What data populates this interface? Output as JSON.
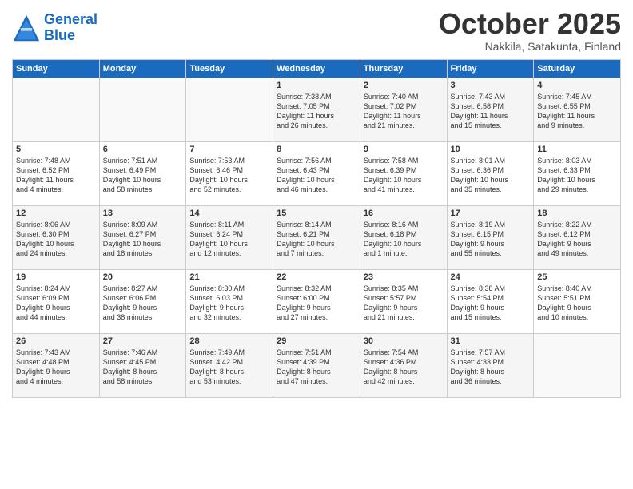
{
  "header": {
    "logo_line1": "General",
    "logo_line2": "Blue",
    "month": "October 2025",
    "location": "Nakkila, Satakunta, Finland"
  },
  "weekdays": [
    "Sunday",
    "Monday",
    "Tuesday",
    "Wednesday",
    "Thursday",
    "Friday",
    "Saturday"
  ],
  "weeks": [
    [
      {
        "day": "",
        "info": ""
      },
      {
        "day": "",
        "info": ""
      },
      {
        "day": "",
        "info": ""
      },
      {
        "day": "1",
        "info": "Sunrise: 7:38 AM\nSunset: 7:05 PM\nDaylight: 11 hours\nand 26 minutes."
      },
      {
        "day": "2",
        "info": "Sunrise: 7:40 AM\nSunset: 7:02 PM\nDaylight: 11 hours\nand 21 minutes."
      },
      {
        "day": "3",
        "info": "Sunrise: 7:43 AM\nSunset: 6:58 PM\nDaylight: 11 hours\nand 15 minutes."
      },
      {
        "day": "4",
        "info": "Sunrise: 7:45 AM\nSunset: 6:55 PM\nDaylight: 11 hours\nand 9 minutes."
      }
    ],
    [
      {
        "day": "5",
        "info": "Sunrise: 7:48 AM\nSunset: 6:52 PM\nDaylight: 11 hours\nand 4 minutes."
      },
      {
        "day": "6",
        "info": "Sunrise: 7:51 AM\nSunset: 6:49 PM\nDaylight: 10 hours\nand 58 minutes."
      },
      {
        "day": "7",
        "info": "Sunrise: 7:53 AM\nSunset: 6:46 PM\nDaylight: 10 hours\nand 52 minutes."
      },
      {
        "day": "8",
        "info": "Sunrise: 7:56 AM\nSunset: 6:43 PM\nDaylight: 10 hours\nand 46 minutes."
      },
      {
        "day": "9",
        "info": "Sunrise: 7:58 AM\nSunset: 6:39 PM\nDaylight: 10 hours\nand 41 minutes."
      },
      {
        "day": "10",
        "info": "Sunrise: 8:01 AM\nSunset: 6:36 PM\nDaylight: 10 hours\nand 35 minutes."
      },
      {
        "day": "11",
        "info": "Sunrise: 8:03 AM\nSunset: 6:33 PM\nDaylight: 10 hours\nand 29 minutes."
      }
    ],
    [
      {
        "day": "12",
        "info": "Sunrise: 8:06 AM\nSunset: 6:30 PM\nDaylight: 10 hours\nand 24 minutes."
      },
      {
        "day": "13",
        "info": "Sunrise: 8:09 AM\nSunset: 6:27 PM\nDaylight: 10 hours\nand 18 minutes."
      },
      {
        "day": "14",
        "info": "Sunrise: 8:11 AM\nSunset: 6:24 PM\nDaylight: 10 hours\nand 12 minutes."
      },
      {
        "day": "15",
        "info": "Sunrise: 8:14 AM\nSunset: 6:21 PM\nDaylight: 10 hours\nand 7 minutes."
      },
      {
        "day": "16",
        "info": "Sunrise: 8:16 AM\nSunset: 6:18 PM\nDaylight: 10 hours\nand 1 minute."
      },
      {
        "day": "17",
        "info": "Sunrise: 8:19 AM\nSunset: 6:15 PM\nDaylight: 9 hours\nand 55 minutes."
      },
      {
        "day": "18",
        "info": "Sunrise: 8:22 AM\nSunset: 6:12 PM\nDaylight: 9 hours\nand 49 minutes."
      }
    ],
    [
      {
        "day": "19",
        "info": "Sunrise: 8:24 AM\nSunset: 6:09 PM\nDaylight: 9 hours\nand 44 minutes."
      },
      {
        "day": "20",
        "info": "Sunrise: 8:27 AM\nSunset: 6:06 PM\nDaylight: 9 hours\nand 38 minutes."
      },
      {
        "day": "21",
        "info": "Sunrise: 8:30 AM\nSunset: 6:03 PM\nDaylight: 9 hours\nand 32 minutes."
      },
      {
        "day": "22",
        "info": "Sunrise: 8:32 AM\nSunset: 6:00 PM\nDaylight: 9 hours\nand 27 minutes."
      },
      {
        "day": "23",
        "info": "Sunrise: 8:35 AM\nSunset: 5:57 PM\nDaylight: 9 hours\nand 21 minutes."
      },
      {
        "day": "24",
        "info": "Sunrise: 8:38 AM\nSunset: 5:54 PM\nDaylight: 9 hours\nand 15 minutes."
      },
      {
        "day": "25",
        "info": "Sunrise: 8:40 AM\nSunset: 5:51 PM\nDaylight: 9 hours\nand 10 minutes."
      }
    ],
    [
      {
        "day": "26",
        "info": "Sunrise: 7:43 AM\nSunset: 4:48 PM\nDaylight: 9 hours\nand 4 minutes."
      },
      {
        "day": "27",
        "info": "Sunrise: 7:46 AM\nSunset: 4:45 PM\nDaylight: 8 hours\nand 58 minutes."
      },
      {
        "day": "28",
        "info": "Sunrise: 7:49 AM\nSunset: 4:42 PM\nDaylight: 8 hours\nand 53 minutes."
      },
      {
        "day": "29",
        "info": "Sunrise: 7:51 AM\nSunset: 4:39 PM\nDaylight: 8 hours\nand 47 minutes."
      },
      {
        "day": "30",
        "info": "Sunrise: 7:54 AM\nSunset: 4:36 PM\nDaylight: 8 hours\nand 42 minutes."
      },
      {
        "day": "31",
        "info": "Sunrise: 7:57 AM\nSunset: 4:33 PM\nDaylight: 8 hours\nand 36 minutes."
      },
      {
        "day": "",
        "info": ""
      }
    ]
  ]
}
